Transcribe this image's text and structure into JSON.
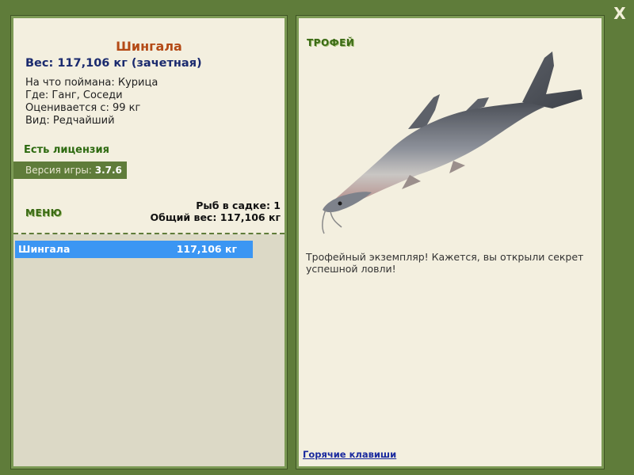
{
  "window": {
    "close_label": "X"
  },
  "fish": {
    "name": "Шингала",
    "weight_line": "Вес: 117,106 кг (зачетная)",
    "info": [
      "На что поймана: Курица",
      "Где: Ганг, Соседи",
      "Оценивается с: 99 кг",
      "Вид: Редчайший"
    ]
  },
  "license": "Есть лицензия",
  "version": {
    "label": "Версия игры:",
    "value": "3.7.6"
  },
  "menu_label": "МЕНЮ",
  "cage": {
    "count_line": "Рыб в садке: 1",
    "total_line": "Общий вес: 117,106 кг"
  },
  "catch_list": [
    {
      "name": "Шингала",
      "weight": "117,106 кг"
    }
  ],
  "trophy": {
    "label": "ТРОФЕЙ",
    "text": "Трофейный экземпляр! Кажется, вы открыли секрет успешной ловли!"
  },
  "hotkeys_label": "Горячие клавиши",
  "colors": {
    "frame": "#5f7c3a",
    "panel_bg": "#f3efdf",
    "highlight_row": "#3b96f3",
    "fish_name": "#b44a16"
  }
}
